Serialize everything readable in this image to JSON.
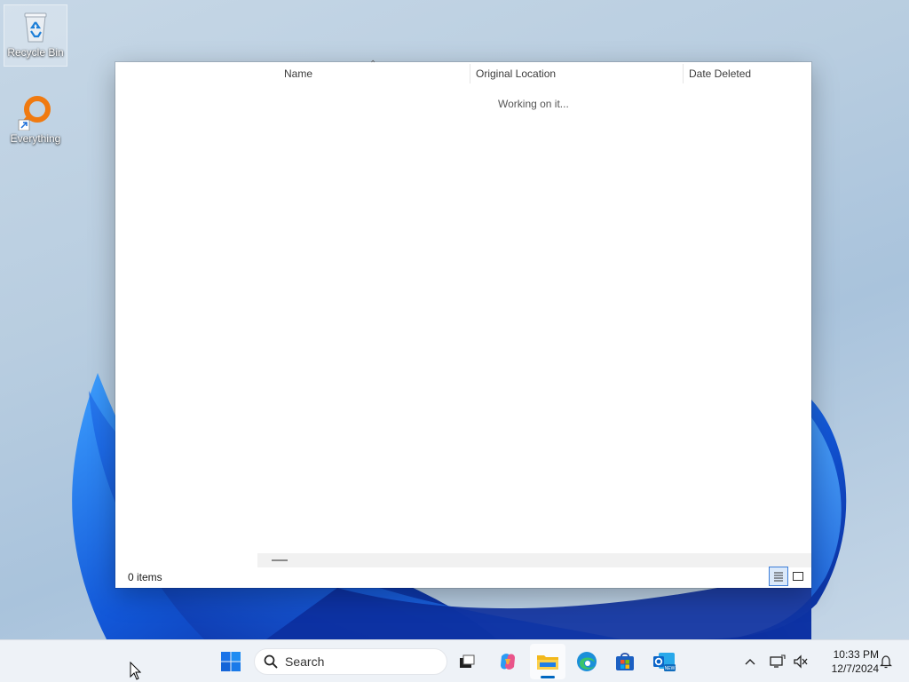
{
  "desktop": {
    "icons": [
      {
        "label": "Recycle Bin",
        "icon": "recycle-bin-icon"
      },
      {
        "label": "Everything",
        "icon": "everything-search-icon"
      }
    ]
  },
  "window": {
    "columns": [
      {
        "label": "Name"
      },
      {
        "label": "Original Location"
      },
      {
        "label": "Date Deleted"
      }
    ],
    "loading_text": "Working on it...",
    "status": "0 items",
    "view_buttons": [
      {
        "icon": "details-view-icon",
        "active": true
      },
      {
        "icon": "large-icons-view-icon",
        "active": false
      }
    ]
  },
  "taskbar": {
    "search_placeholder": "Search",
    "apps": [
      {
        "icon": "start-icon"
      },
      {
        "icon": "task-view-icon"
      },
      {
        "icon": "copilot-icon"
      },
      {
        "icon": "file-explorer-icon",
        "active": true
      },
      {
        "icon": "edge-icon"
      },
      {
        "icon": "microsoft-store-icon"
      },
      {
        "icon": "outlook-new-icon",
        "badge": "NEW"
      }
    ],
    "tray": {
      "icons": [
        "show-hidden-icons-chevron",
        "network-icon",
        "volume-muted-icon",
        "notification-icon"
      ]
    },
    "clock": {
      "time": "10:33 PM",
      "date": "12/7/2024"
    }
  },
  "colors": {
    "accent": "#0067c0",
    "bloom_dark": "#0a2a9a",
    "bloom_light": "#2f8cf0"
  }
}
